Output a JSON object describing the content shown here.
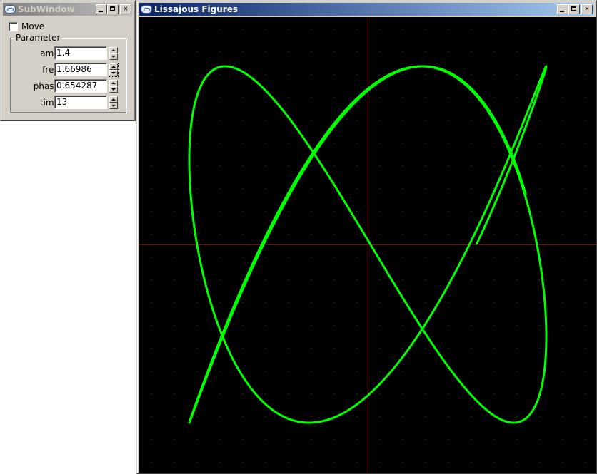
{
  "subwindow": {
    "title": "SubWindow",
    "move_label": "Move",
    "move_checked": false,
    "group_label": "Parameter",
    "params": [
      {
        "label": "amp:",
        "value": "1.4"
      },
      {
        "label": "freq:",
        "value": "1.66986"
      },
      {
        "label": "phase:",
        "value": "0.654287"
      },
      {
        "label": "time:",
        "value": "13"
      }
    ]
  },
  "plot_window": {
    "title": "Lissajous Figures"
  },
  "colors": {
    "curve": "#00ff00",
    "axes": "#8b0000",
    "grid_dots": "#3a3a3a",
    "plot_background": "#000000"
  }
}
